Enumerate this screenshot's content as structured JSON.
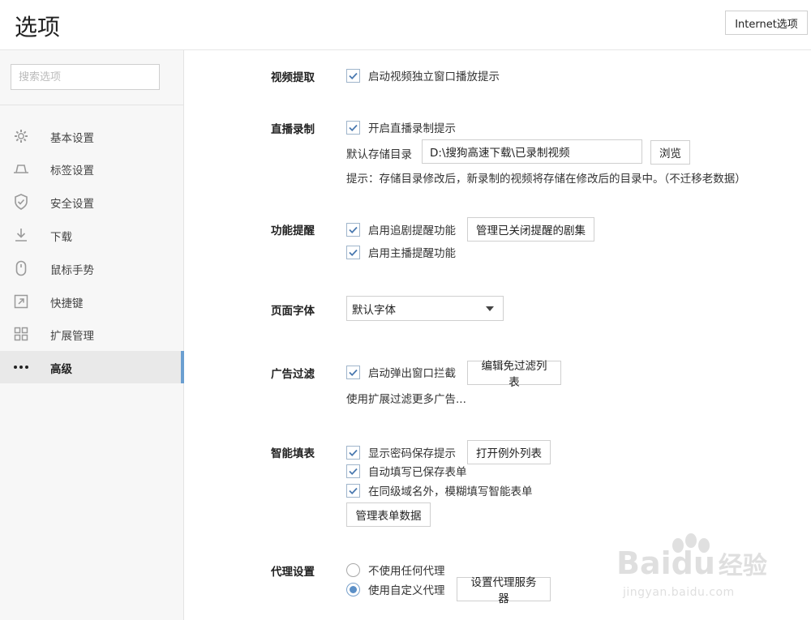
{
  "header": {
    "title": "选项",
    "internet_button": "Internet选项"
  },
  "sidebar": {
    "search_placeholder": "搜索选项",
    "items": [
      {
        "label": "基本设置",
        "icon": "gear-icon"
      },
      {
        "label": "标签设置",
        "icon": "tab-icon"
      },
      {
        "label": "安全设置",
        "icon": "shield-icon"
      },
      {
        "label": "下载",
        "icon": "download-icon"
      },
      {
        "label": "鼠标手势",
        "icon": "mouse-icon"
      },
      {
        "label": "快捷键",
        "icon": "shortcut-icon"
      },
      {
        "label": "扩展管理",
        "icon": "extensions-icon"
      },
      {
        "label": "高级",
        "icon": "more-icon",
        "active": true
      }
    ]
  },
  "sections": {
    "video": {
      "title": "视频提取",
      "opt1": "启动视频独立窗口播放提示"
    },
    "live": {
      "title": "直播录制",
      "opt1": "开启直播录制提示",
      "dir_label": "默认存储目录",
      "dir_value": "D:\\搜狗高速下载\\已录制视频",
      "browse": "浏览",
      "hint": "提示：存储目录修改后，新录制的视频将存储在修改后的目录中。（不迁移老数据）"
    },
    "reminder": {
      "title": "功能提醒",
      "opt1": "启用追剧提醒功能",
      "manage_btn": "管理已关闭提醒的剧集",
      "opt2": "启用主播提醒功能"
    },
    "font": {
      "title": "页面字体",
      "selected": "默认字体"
    },
    "adblock": {
      "title": "广告过滤",
      "opt1": "启动弹出窗口拦截",
      "edit_btn": "编辑免过滤列表",
      "link": "使用扩展过滤更多广告..."
    },
    "autofill": {
      "title": "智能填表",
      "opt1": "显示密码保存提示",
      "exceptions_btn": "打开例外列表",
      "opt2": "自动填写已保存表单",
      "opt3": "在同级域名外，模糊填写智能表单",
      "manage_btn": "管理表单数据"
    },
    "proxy": {
      "title": "代理设置",
      "opt1": "不使用任何代理",
      "opt2": "使用自定义代理",
      "server_btn": "设置代理服务器"
    }
  },
  "watermark": {
    "brand": "Bai",
    "brand2": "du",
    "cn": "经验",
    "url": "jingyan.baidu.com"
  }
}
